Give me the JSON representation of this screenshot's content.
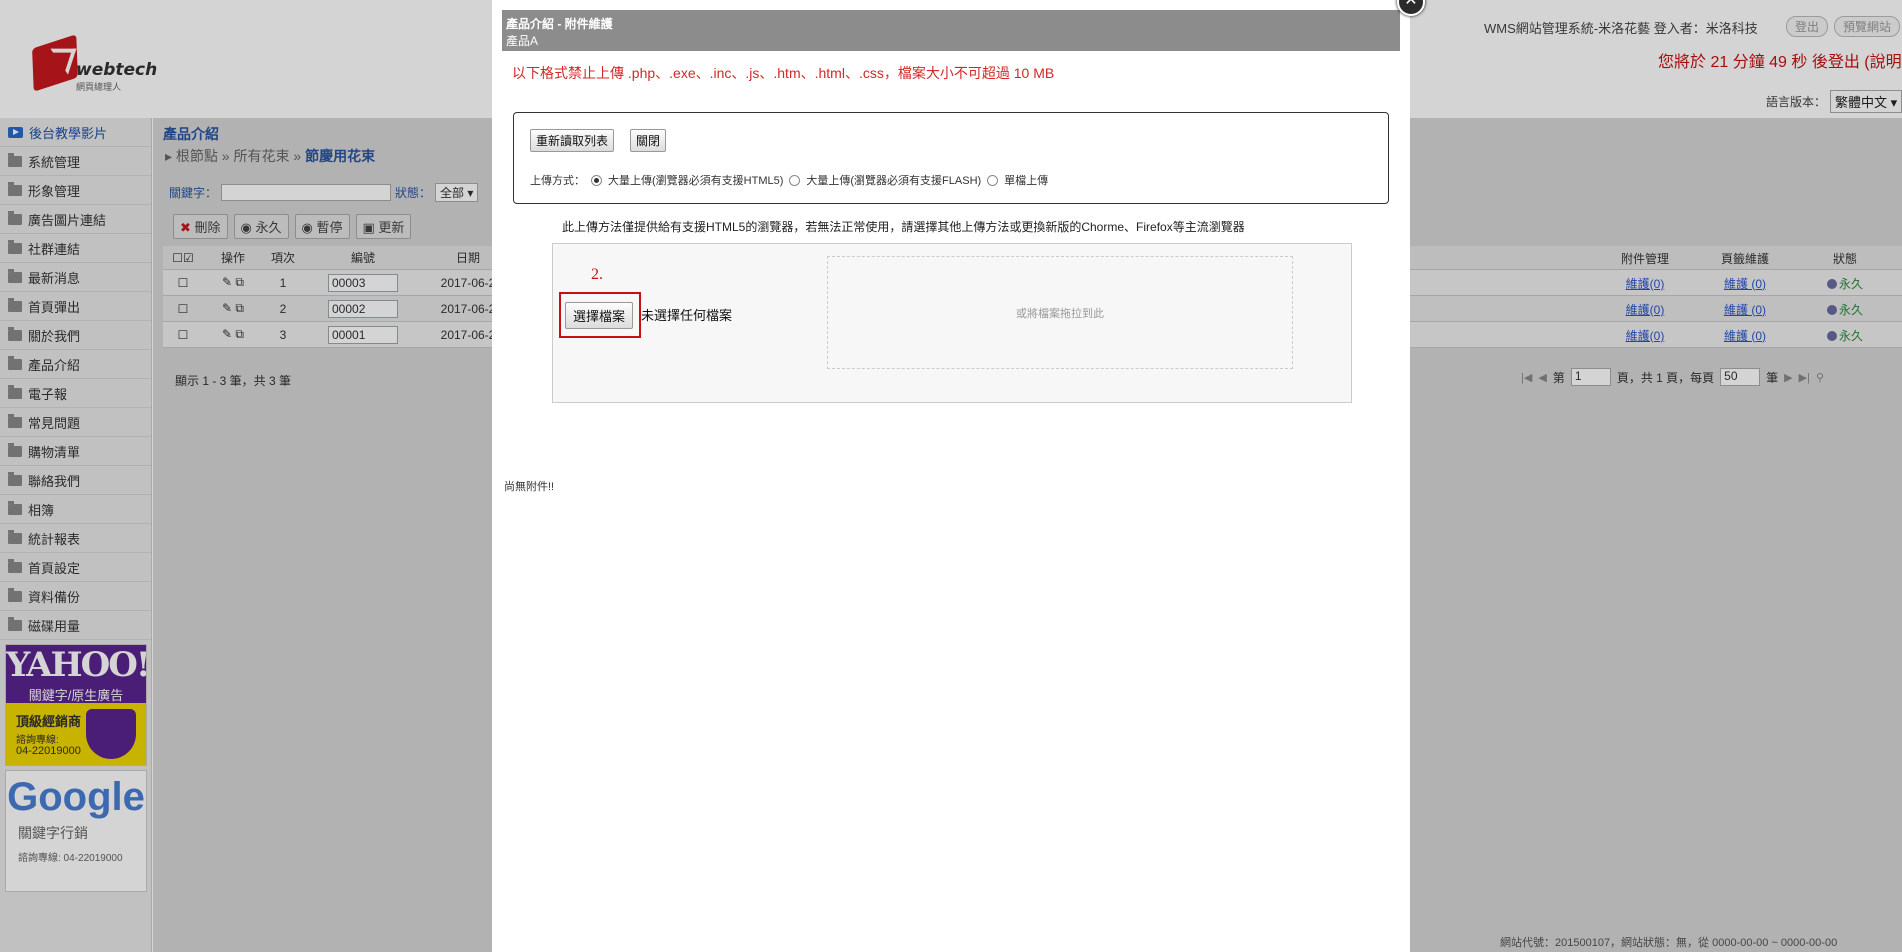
{
  "header": {
    "brand": "webtech",
    "brand_sub": "網頁總理人",
    "system_info": "WMS網站管理系統-米洛花藝   登入者：米洛科技",
    "logout_button": "登出",
    "preview_button": "預覽網站",
    "logout_countdown": "您將於 21 分鐘 49 秒 後登出 (說明",
    "language_label": "語言版本：",
    "language_value": "繁體中文 ▾"
  },
  "sidebar": {
    "items": [
      "後台教學影片",
      "系統管理",
      "形象管理",
      "廣告圖片連結",
      "社群連結",
      "最新消息",
      "首頁彈出",
      "關於我們",
      "產品介紹",
      "電子報",
      "常見問題",
      "購物清單",
      "聯絡我們",
      "相簿",
      "統計報表",
      "首頁設定",
      "資料備份",
      "磁碟用量"
    ],
    "ad_yahoo": {
      "logo": "YAHOO!",
      "line1": "關鍵字/原生廣告",
      "line2": "頂級經銷商",
      "line3": "諮詢專線:",
      "phone": "04-22019000"
    },
    "ad_google": {
      "logo": "Google",
      "line1": "關鍵字行銷",
      "line2": "諮詢專線: 04-22019000"
    }
  },
  "content": {
    "title": "產品介紹",
    "breadcrumb_1": "根節點",
    "breadcrumb_2": "所有花束",
    "breadcrumb_3": "節慶用花束",
    "keyword_label": "關鍵字：",
    "status_label": "狀態：",
    "status_value": "全部 ▾",
    "toolbar": {
      "delete": "刪除",
      "permanent": "永久",
      "pause": "暫停",
      "update": "更新"
    },
    "columns": [
      "操作",
      "項次",
      "編號",
      "日期"
    ],
    "right_columns": [
      "附件管理",
      "頁籤維護",
      "狀態"
    ],
    "rows": [
      {
        "no": "1",
        "code": "00003",
        "date": "2017-06-2",
        "attach": "維護(0)",
        "tab": "維護 (0)",
        "status": "永久"
      },
      {
        "no": "2",
        "code": "00002",
        "date": "2017-06-2",
        "attach": "維護(0)",
        "tab": "維護 (0)",
        "status": "永久"
      },
      {
        "no": "3",
        "code": "00001",
        "date": "2017-06-2",
        "attach": "維護(0)",
        "tab": "維護 (0)",
        "status": "永久"
      }
    ],
    "count_text": "顯示 1 - 3 筆，共 3 筆",
    "pager": {
      "page_label": "第",
      "page_value": "1",
      "pages_text": "頁，共 1 頁，每頁",
      "per_page": "50",
      "unit": "筆"
    },
    "footer": "網站代號：201500107，網站狀態：無，從 0000-00-00 ~ 0000-00-00"
  },
  "modal": {
    "title": "產品介紹 - 附件維護",
    "subtitle": "產品A",
    "warning": "以下格式禁止上傳 .php、.exe、.inc、.js、.htm、.html、.css，檔案大小不可超過 10 MB",
    "reload_button": "重新讀取列表",
    "close_button": "關閉",
    "upload_mode_label": "上傳方式：",
    "mode_options": [
      "大量上傳(瀏覽器必須有支援HTML5)",
      "大量上傳(瀏覽器必須有支援FLASH)",
      "單檔上傳"
    ],
    "selected_mode": 0,
    "note": "此上傳方法僅提供給有支援HTML5的瀏覽器，若無法正常使用，請選擇其他上傳方法或更換新版的Chorme、Firefox等主流瀏覽器",
    "step_marker": "2.",
    "choose_file_button": "選擇檔案",
    "no_file_text": "未選擇任何檔案",
    "drop_zone_text": "或將檔案拖拉到此",
    "no_attachment_text": "尚無附件!!"
  },
  "colors": {
    "accent_red": "#c81010",
    "link_blue": "#2a55c8",
    "modal_header": "#8c8c8c"
  }
}
